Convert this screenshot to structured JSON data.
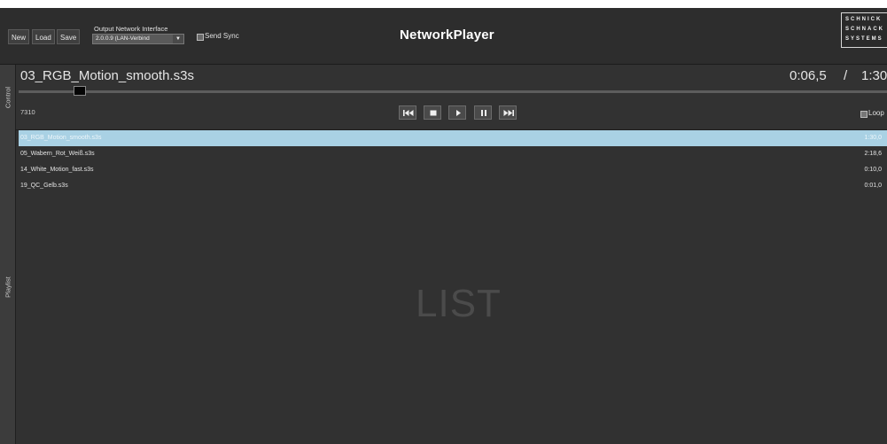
{
  "header": {
    "new_label": "New",
    "load_label": "Load",
    "save_label": "Save",
    "output_interface_label": "Output Network Interface",
    "output_interface_value": "2.0.0.9 (LAN-Verbind",
    "send_sync_label": "Send Sync",
    "app_title": "NetworkPlayer",
    "logo_lines": [
      "SCHNICK",
      "SCHNACK",
      "SYSTEMS"
    ]
  },
  "side_tabs": {
    "control": "Control",
    "playlist": "Playlist"
  },
  "control": {
    "track_title": "03_RGB_Motion_smooth.s3s",
    "time_current": "0:06,5",
    "time_separator": "/",
    "time_total": "1:30",
    "frame_count": "7310",
    "seek_progress": 0.07,
    "loop_label": "Loop",
    "transport_icons": [
      "skip-back-icon",
      "stop-icon",
      "play-icon",
      "pause-icon",
      "skip-forward-icon"
    ]
  },
  "playlist": {
    "items": [
      {
        "name": "03_RGB_Motion_smooth.s3s",
        "duration": "1:30,0",
        "selected": true
      },
      {
        "name": "05_Wabern_Rot_Weiß.s3s",
        "duration": "2:18,6",
        "selected": false
      },
      {
        "name": "14_White_Motion_fast.s3s",
        "duration": "0:10,0",
        "selected": false
      },
      {
        "name": "19_QC_Gelb.s3s",
        "duration": "0:01,0",
        "selected": false
      }
    ],
    "watermark": "LIST"
  },
  "colors": {
    "background": "#323232",
    "header": "#2d2d2d",
    "selection": "#a9d1e4",
    "text": "#e3e3e3"
  }
}
